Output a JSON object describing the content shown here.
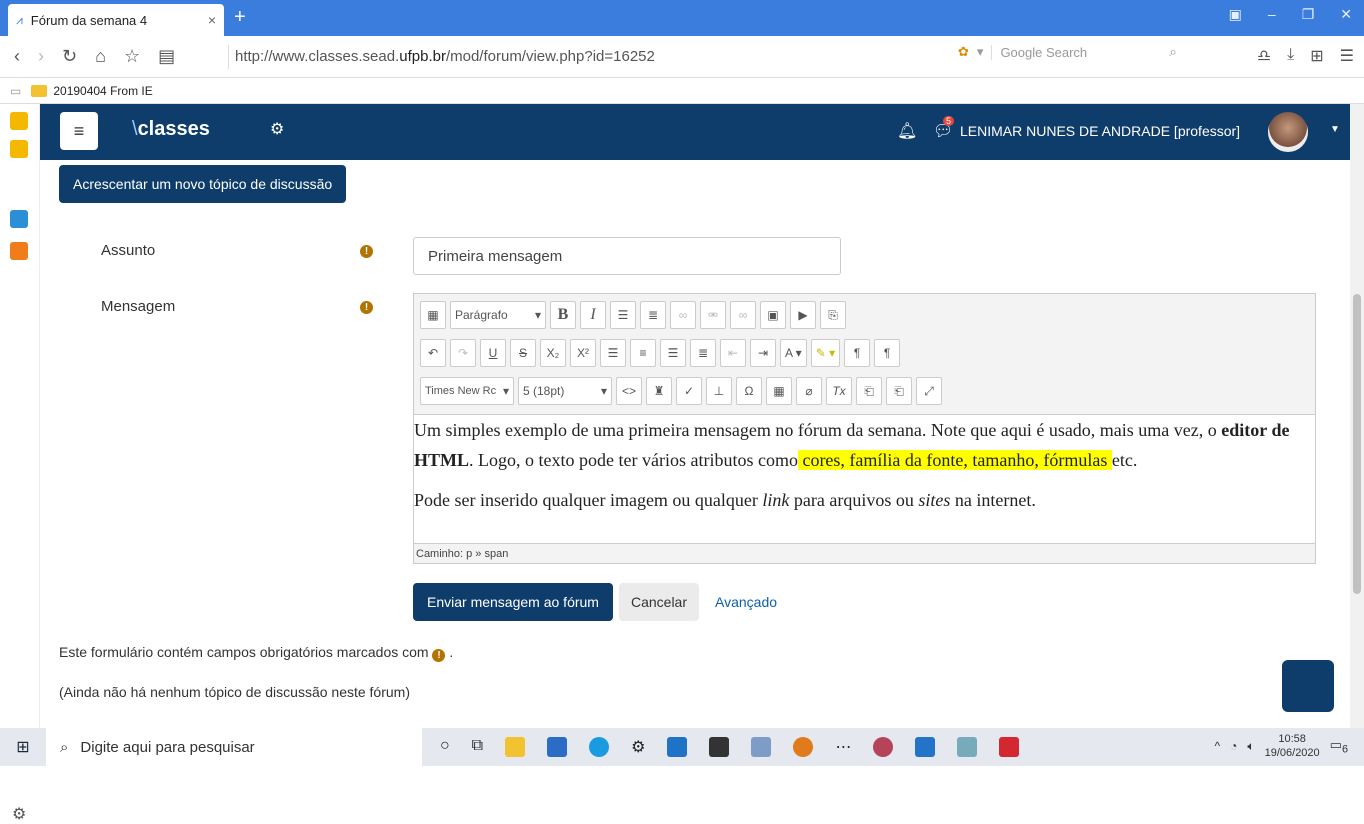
{
  "browser": {
    "tab_title": "Fórum da semana 4",
    "tab_close": "×",
    "new_tab": "+",
    "url_pre": "http://www.classes.sead.",
    "url_bold": "ufpb.br",
    "url_post": "/mod/forum/view.php?id=16252",
    "search_placeholder": "Google Search",
    "bookmark_folder": "20190404 From IE"
  },
  "navbar": {
    "brand_icon": "\\",
    "brand": "classes",
    "notification_count": "5",
    "user_name": "LENIMAR NUNES DE ANDRADE [professor]"
  },
  "main": {
    "add_topic_button": "Acrescentar um novo tópico de discussão",
    "subject_label": "Assunto",
    "subject_value": "Primeira mensagem",
    "message_label": "Mensagem",
    "required_mark": "!",
    "toolbar": {
      "format_select": "Parágrafo",
      "font_select": "Times New Rc",
      "size_select": "5 (18pt)"
    },
    "editor": {
      "p1_a": "Um simples exemplo de uma primeira mensagem no fórum da semana. Note que aqui é usado, mais uma vez, o ",
      "p1_bold": "editor de HTML",
      "p1_b": ". Logo, o texto pode ter vários atributos como",
      "p1_highlight": " cores, família da fonte, tamanho, fórmulas ",
      "p1_c": "etc.",
      "p2_a": "Pode ser inserido qualquer imagem ou qualquer ",
      "p2_link": "link",
      "p2_b": " para arquivos ou ",
      "p2_sites": "sites",
      "p2_c": " na internet.",
      "path": "Caminho: p » span"
    },
    "submit_button": "Enviar mensagem ao fórum",
    "cancel_button": "Cancelar",
    "advanced_link": "Avançado",
    "required_note": "Este formulário contém campos obrigatórios marcados com",
    "required_note_end": ".",
    "no_topics": "(Ainda não há nenhum tópico de discussão neste fórum)"
  },
  "taskbar": {
    "search_placeholder": "Digite aqui para pesquisar",
    "time": "10:58",
    "date": "19/06/2020",
    "notifications": "6"
  }
}
